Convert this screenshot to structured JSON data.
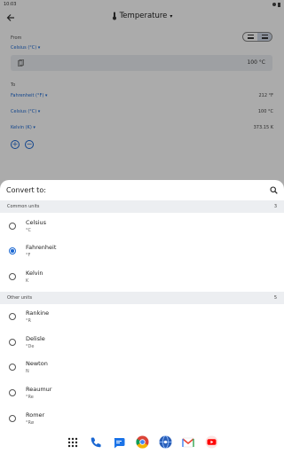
{
  "status_bar": {
    "time": "10:03"
  },
  "app": {
    "title": "Temperature",
    "from_label": "From",
    "from_unit": "Celsius (°C) ▾",
    "input_value": "100 °C",
    "to_label": "To",
    "results": [
      {
        "unit": "Fahrenheit (°F) ▾",
        "value": "212 °F"
      },
      {
        "unit": "Celsius (°C) ▾",
        "value": "100 °C"
      },
      {
        "unit": "Kelvin (K) ▾",
        "value": "373.15 K"
      }
    ],
    "add_label": "+",
    "remove_label": "−"
  },
  "sheet": {
    "title": "Convert to:",
    "sections": [
      {
        "label": "Common units",
        "count": "3",
        "options": [
          {
            "name": "Celsius",
            "symbol": "°C",
            "selected": false
          },
          {
            "name": "Fahrenheit",
            "symbol": "°F",
            "selected": true
          },
          {
            "name": "Kelvin",
            "symbol": "K",
            "selected": false
          }
        ]
      },
      {
        "label": "Other units",
        "count": "5",
        "options": [
          {
            "name": "Rankine",
            "symbol": "°R",
            "selected": false
          },
          {
            "name": "Delisle",
            "symbol": "°De",
            "selected": false
          },
          {
            "name": "Newton",
            "symbol": "N",
            "selected": false
          },
          {
            "name": "Reaumur",
            "symbol": "°Re",
            "selected": false
          },
          {
            "name": "Romer",
            "symbol": "°Rø",
            "selected": false
          }
        ]
      }
    ]
  },
  "dock": {
    "icons": [
      "apps-grid-icon",
      "phone-icon",
      "messages-icon",
      "chrome-icon",
      "browser-globe-icon",
      "gmail-icon",
      "youtube-icon"
    ]
  },
  "colors": {
    "accent": "#1a67d2",
    "scrim": "rgba(0,0,0,0.33)",
    "section_bg": "#eceef1"
  }
}
